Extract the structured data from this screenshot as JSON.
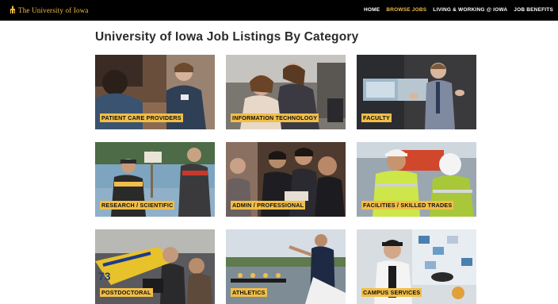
{
  "header": {
    "brand": "The University of Iowa",
    "nav": [
      {
        "label": "HOME",
        "active": false
      },
      {
        "label": "BROWSE JOBS",
        "active": true
      },
      {
        "label": "LIVING & WORKING @ IOWA",
        "active": false
      },
      {
        "label": "JOB BENEFITS",
        "active": false
      }
    ]
  },
  "page_title": "University of Iowa Job Listings By Category",
  "categories": [
    {
      "label": "PATIENT CARE PROVIDERS"
    },
    {
      "label": "INFORMATION TECHNOLOGY"
    },
    {
      "label": "FACULTY"
    },
    {
      "label": "RESEARCH / SCIENTIFIC"
    },
    {
      "label": "ADMIN / PROFESSIONAL"
    },
    {
      "label": "FACILITIES / SKILLED TRADES"
    },
    {
      "label": "POSTDOCTORAL"
    },
    {
      "label": "ATHLETICS"
    },
    {
      "label": "CAMPUS SERVICES"
    }
  ],
  "colors": {
    "accent": "#f1be48",
    "header_bg": "#000000"
  }
}
